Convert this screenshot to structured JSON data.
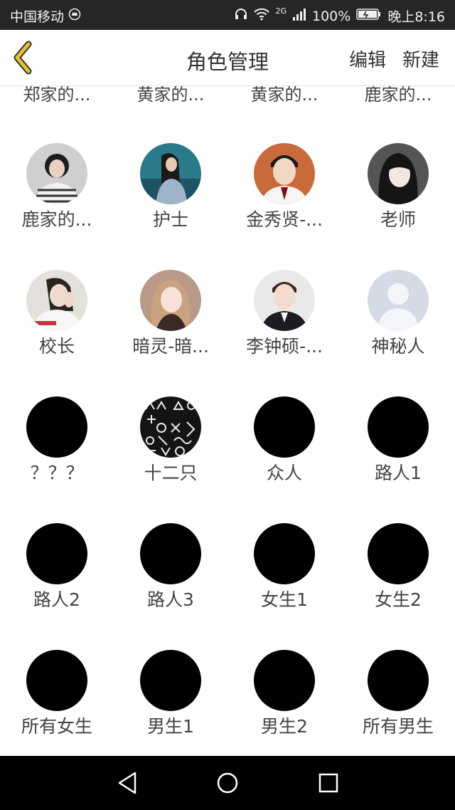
{
  "status_bar": {
    "carrier": "中国移动",
    "network": "2G",
    "battery": "100%",
    "time": "晚上8:16"
  },
  "nav": {
    "title": "角色管理",
    "edit": "编辑",
    "new": "新建"
  },
  "partial_row": [
    "郑家的...",
    "黄家的...",
    "黄家的...",
    "鹿家的..."
  ],
  "characters": [
    {
      "name": "鹿家的...",
      "avatar": "photo-girl-bob"
    },
    {
      "name": "护士",
      "avatar": "photo-girl-outdoor"
    },
    {
      "name": "金秀贤-...",
      "avatar": "photo-man-suit"
    },
    {
      "name": "老师",
      "avatar": "photo-girl-dark"
    },
    {
      "name": "校长",
      "avatar": "photo-girl-hand"
    },
    {
      "name": "暗灵-暗...",
      "avatar": "photo-girl-blonde"
    },
    {
      "name": "李钟硕-...",
      "avatar": "photo-man-blazer"
    },
    {
      "name": "神秘人",
      "avatar": "default-silhouette"
    },
    {
      "name": "？？？",
      "avatar": "black"
    },
    {
      "name": "十二只",
      "avatar": "symbols-pattern"
    },
    {
      "name": "众人",
      "avatar": "black"
    },
    {
      "name": "路人1",
      "avatar": "black"
    },
    {
      "name": "路人2",
      "avatar": "black"
    },
    {
      "name": "路人3",
      "avatar": "black"
    },
    {
      "name": "女生1",
      "avatar": "black"
    },
    {
      "name": "女生2",
      "avatar": "black"
    },
    {
      "name": "所有女生",
      "avatar": "black"
    },
    {
      "name": "男生1",
      "avatar": "black"
    },
    {
      "name": "男生2",
      "avatar": "black"
    },
    {
      "name": "所有男生",
      "avatar": "black"
    }
  ],
  "colors": {
    "accent": "#e8c12d",
    "status_bar": "#262626",
    "default_avatar": "#d5dbe6"
  }
}
